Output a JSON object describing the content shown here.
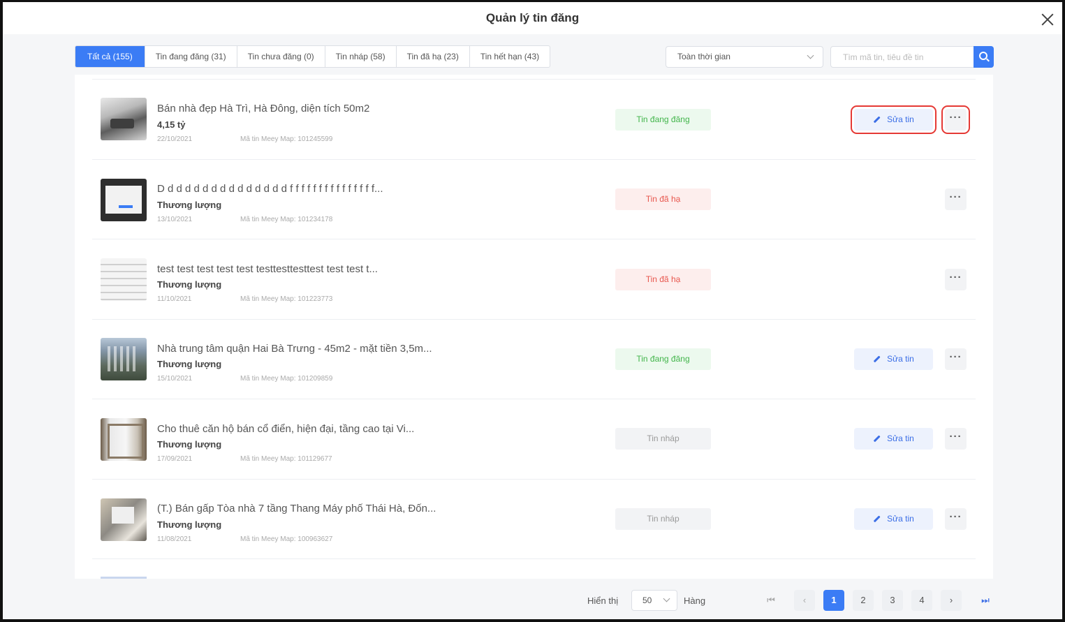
{
  "dialog": {
    "title": "Quản lý tin đăng"
  },
  "tabs": [
    {
      "label": "Tất cả (155)",
      "active": true
    },
    {
      "label": "Tin đang đăng (31)"
    },
    {
      "label": "Tin chưa đăng (0)"
    },
    {
      "label": "Tin nháp (58)"
    },
    {
      "label": "Tin đã hạ (23)"
    },
    {
      "label": "Tin hết hạn (43)"
    }
  ],
  "filters": {
    "time_value": "Toàn thời gian",
    "search_placeholder": "Tìm mã tin, tiêu đề tin"
  },
  "listings": [
    {
      "thumb": "house-interior-photo",
      "title": "Bán nhà đẹp Hà Trì, Hà Đông, diện tích 50m2",
      "price": "4,15 tỷ",
      "date": "22/10/2021",
      "code": "Mã tin Meey Map: 101245599",
      "status": "Tin đang đăng",
      "status_color": "#42b54b",
      "has_edit": true,
      "edit_label": "Sửa tin",
      "highlighted": true
    },
    {
      "thumb": "screenshot-thumbnail",
      "title": "D d d d d d d d d d d d d d d f f f f f f f f f f f f f f f...",
      "price": "Thương lượng",
      "date": "13/10/2021",
      "code": "Mã tin Meey Map: 101234178",
      "status": "Tin đã hạ",
      "status_color": "#e8574e",
      "has_edit": false
    },
    {
      "thumb": "form-thumbnail",
      "title": "test test test test test testtesttesttest test test t...",
      "price": "Thương lượng",
      "date": "11/10/2021",
      "code": "Mã tin Meey Map: 101223773",
      "status": "Tin đã hạ",
      "status_color": "#e8574e",
      "has_edit": false
    },
    {
      "thumb": "building-photo",
      "title": "Nhà trung tâm quận Hai Bà Trưng - 45m2 - mặt tiền 3,5m...",
      "price": "Thương lượng",
      "date": "15/10/2021",
      "code": "Mã tin Meey Map: 101209859",
      "status": "Tin đang đăng",
      "status_color": "#42b54b",
      "has_edit": true,
      "edit_label": "Sửa tin"
    },
    {
      "thumb": "apartment-window-photo",
      "title": "Cho thuê căn hộ bán cổ điển, hiện đại, tầng cao tại Vi...",
      "price": "Thương lượng",
      "date": "17/09/2021",
      "code": "Mã tin Meey Map: 101129677",
      "status": "Tin nháp",
      "status_color": "#999999",
      "has_edit": true,
      "edit_label": "Sửa tin"
    },
    {
      "thumb": "interior-photo",
      "title": "(T.) Bán gấp Tòa nhà 7 tầng Thang Máy phố Thái Hà, Đốn...",
      "price": "Thương lượng",
      "date": "11/08/2021",
      "code": "Mã tin Meey Map: 100963627",
      "status": "Tin nháp",
      "status_color": "#999999",
      "has_edit": true,
      "edit_label": "Sửa tin"
    }
  ],
  "more_label": "···",
  "pagination": {
    "show_label": "Hiển thị",
    "page_size": "50",
    "rows_label": "Hàng",
    "pages": [
      "1",
      "2",
      "3",
      "4"
    ],
    "current_page": "1",
    "first_icon": "⏮",
    "prev_icon": "‹",
    "next_icon": "›",
    "last_icon": "⏭"
  },
  "colors": {
    "accent": "#3b7cf5",
    "highlight": "#e53935"
  }
}
